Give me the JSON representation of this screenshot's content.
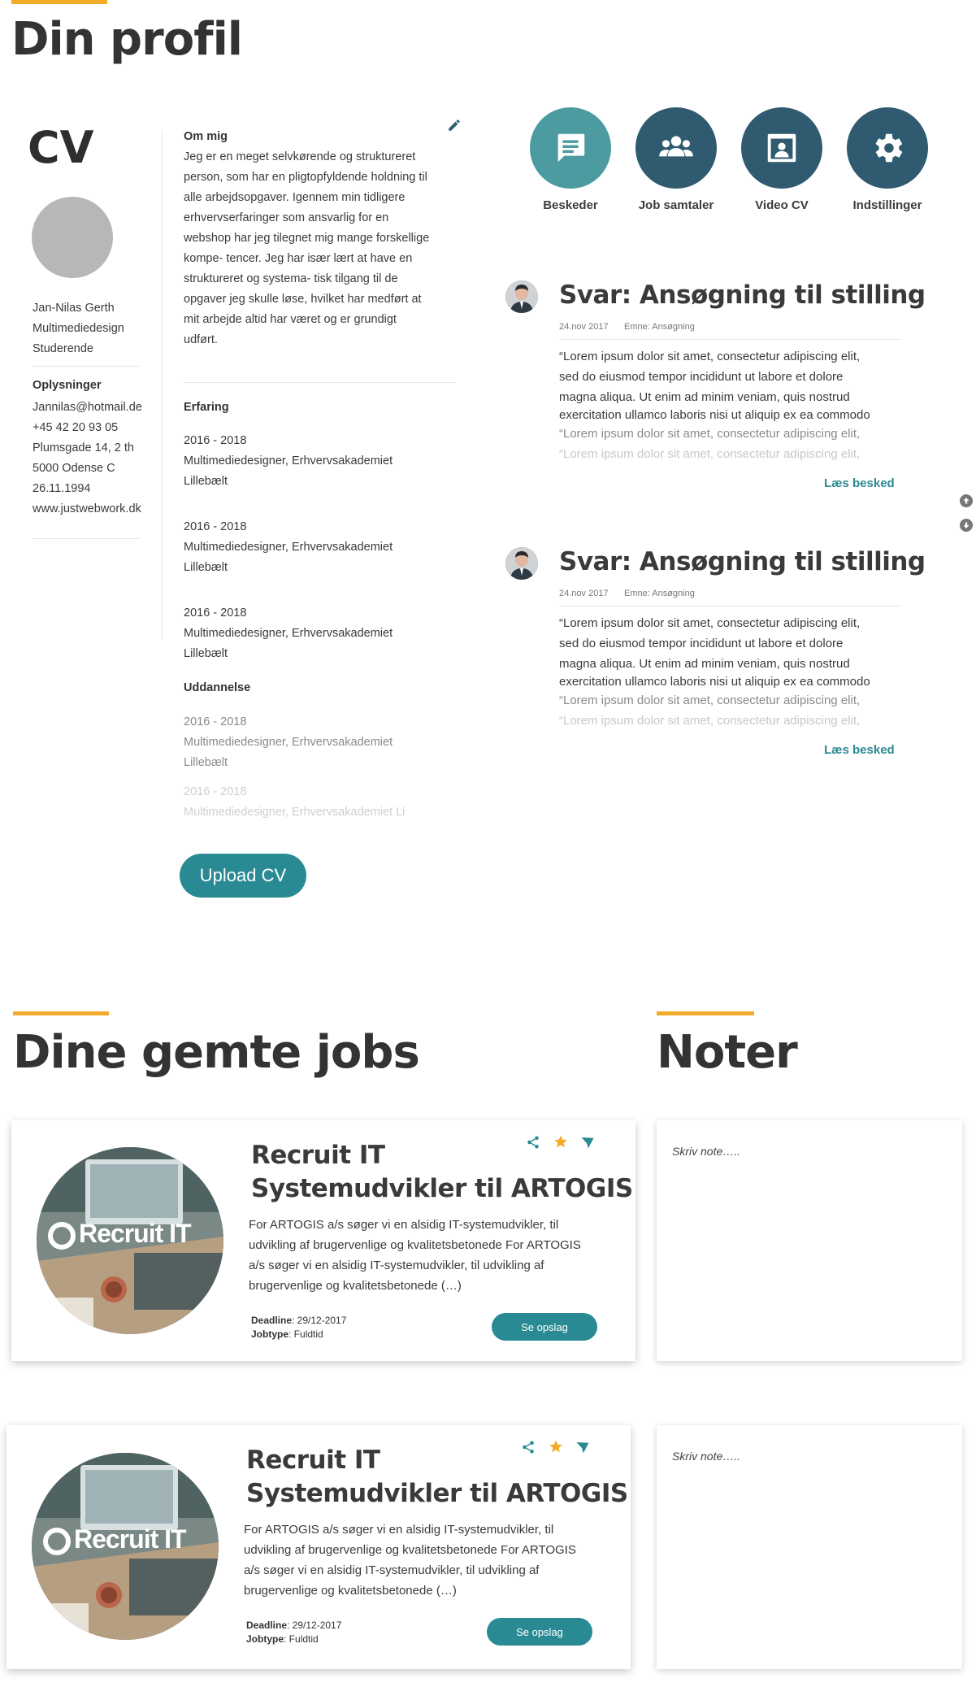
{
  "profile": {
    "title": "Din profil",
    "cv_title": "CV",
    "person": {
      "name": "Jan-Nilas Gerth",
      "education": "Multimediedesign",
      "status": "Studerende"
    },
    "info": {
      "label": "Oplysninger",
      "email": "Jannilas@hotmail.de",
      "phone": "+45 42 20 93 05",
      "street": "Plumsgade 14, 2 th",
      "city": "5000 Odense C",
      "birthdate": "26.11.1994",
      "website": "www.justwebwork.dk"
    },
    "about": {
      "label": "Om mig",
      "lines": [
        "Jeg er en meget selvkørende og struktureret",
        "person, som har en pligtopfyldende holdning til",
        "alle arbejdsopgaver. Igennem min tidligere",
        "erhvervserfaringer som ansvarlig for en",
        "webshop har jeg tilegnet mig mange forskellige",
        "kompe- tencer. Jeg har især lært at have en",
        "struktureret og systema- tisk tilgang til de",
        "opgaver jeg skulle løse, hvilket har medført at",
        "mit arbejde altid har været og er grundigt",
        "udført."
      ]
    },
    "experience": {
      "label": "Erfaring",
      "items": [
        {
          "period": "2016 - 2018",
          "role": "Multimediedesigner, Erhvervsakademiet",
          "place": "Lillebælt"
        },
        {
          "period": "2016 - 2018",
          "role": "Multimediedesigner, Erhvervsakademiet",
          "place": "Lillebælt"
        },
        {
          "period": "2016 - 2018",
          "role": "Multimediedesigner, Erhvervsakademiet",
          "place": "Lillebælt"
        }
      ]
    },
    "education": {
      "label": "Uddannelse",
      "items": [
        {
          "period": "2016 - 2018",
          "role": "Multimediedesigner, Erhvervsakademiet",
          "place": "Lillebælt"
        },
        {
          "period": "2016 - 2018",
          "role": "Multimediedesigner, Erhvervsakademiet Li",
          "place": ""
        }
      ]
    },
    "upload_label": "Upload CV"
  },
  "nav": [
    {
      "label": "Beskeder",
      "icon": "message-icon",
      "color": "#4b9ba1"
    },
    {
      "label": "Job samtaler",
      "icon": "people-icon",
      "color": "#2f5a70"
    },
    {
      "label": "Video CV",
      "icon": "video-cv-icon",
      "color": "#2f5a70"
    },
    {
      "label": "Indstillinger",
      "icon": "gear-icon",
      "color": "#2f5a70"
    }
  ],
  "messages": [
    {
      "title": "Svar: Ansøgning til stilling",
      "date": "24.nov 2017",
      "subject": "Emne: Ansøgning",
      "lines": [
        "“Lorem ipsum dolor sit amet, consectetur adipiscing elit,",
        "sed do eiusmod tempor incididunt ut labore et dolore",
        "magna aliqua. Ut enim ad minim veniam, quis nostrud",
        "exercitation ullamco laboris nisi ut aliquip ex ea commodo",
        "“Lorem ipsum dolor sit amet, consectetur adipiscing elit,",
        "“Lorem ipsum dolor sit amet, consectetur adipiscing elit,"
      ],
      "link": "Læs besked"
    },
    {
      "title": "Svar: Ansøgning til stilling",
      "date": "24.nov 2017",
      "subject": "Emne: Ansøgning",
      "lines": [
        "“Lorem ipsum dolor sit amet, consectetur adipiscing elit,",
        "sed do eiusmod tempor incididunt ut labore et dolore",
        "magna aliqua. Ut enim ad minim veniam, quis nostrud",
        "exercitation ullamco laboris nisi ut aliquip ex ea commodo",
        "“Lorem ipsum dolor sit amet, consectetur adipiscing elit,",
        "“Lorem ipsum dolor sit amet, consectetur adipiscing elit,"
      ],
      "link": "Læs besked"
    }
  ],
  "saved_jobs": {
    "title": "Dine gemte jobs",
    "items": [
      {
        "logo_text": "Recruit IT",
        "company": "Recruit IT",
        "position": "Systemudvikler til ARTOGIS",
        "desc_lines": [
          "For ARTOGIS a/s søger vi en alsidig IT-systemudvikler, til",
          "udvikling af brugervenlige og kvalitetsbetonede For ARTOGIS",
          "a/s søger vi en alsidig IT-systemudvikler, til udvikling af",
          "brugervenlige og kvalitetsbetonede (…)"
        ],
        "deadline_label": "Deadline",
        "deadline": ": 29/12-2017",
        "jobtype_label": "Jobtype",
        "jobtype": ": Fuldtid",
        "button": "Se opslag"
      },
      {
        "logo_text": "Recruit IT",
        "company": "Recruit IT",
        "position": "Systemudvikler til ARTOGIS",
        "desc_lines": [
          "For ARTOGIS a/s søger vi en alsidig IT-systemudvikler, til",
          "udvikling af brugervenlige og kvalitetsbetonede For ARTOGIS",
          "a/s søger vi en alsidig IT-systemudvikler, til udvikling af",
          "brugervenlige og kvalitetsbetonede (…)"
        ],
        "deadline_label": "Deadline",
        "deadline": ": 29/12-2017",
        "jobtype_label": "Jobtype",
        "jobtype": ": Fuldtid",
        "button": "Se opslag"
      }
    ]
  },
  "notes": {
    "title": "Noter",
    "placeholder": "Skriv note…..",
    "items": [
      "Skriv note…..",
      "Skriv note….."
    ]
  },
  "colors": {
    "accent": "#f2ac2a",
    "teal": "#2a8a93",
    "dark_teal": "#2f5a70"
  }
}
